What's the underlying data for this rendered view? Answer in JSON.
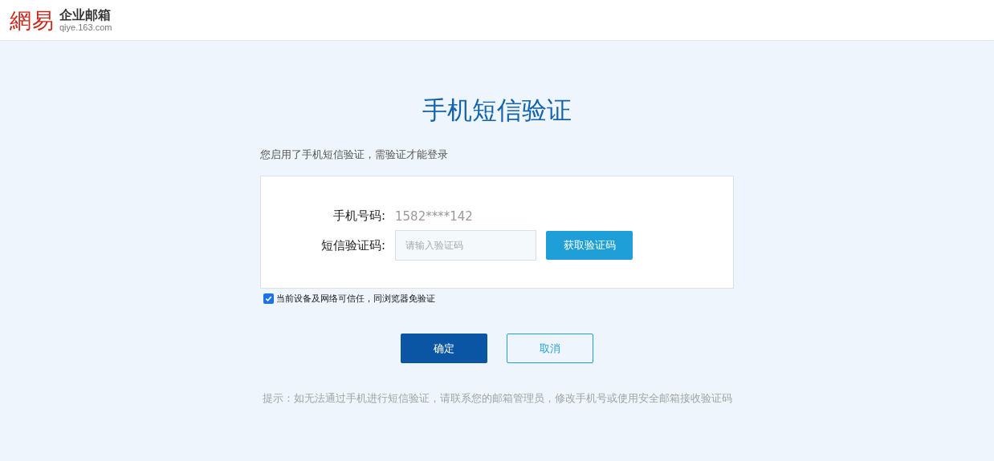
{
  "header": {
    "logo_mark": "網易",
    "product": "企业邮箱",
    "domain": "qiye.163.com"
  },
  "title": "手机短信验证",
  "subtitle": "您启用了手机短信验证，需验证才能登录",
  "form": {
    "phone_label": "手机号码:",
    "phone_value": "1582****142",
    "code_label": "短信验证码:",
    "code_placeholder": "请输入验证码",
    "get_code_button": "获取验证码"
  },
  "trust_device": {
    "label": "当前设备及网络可信任，同浏览器免验证",
    "checked": true
  },
  "buttons": [
    {
      "kind": "primary",
      "label": "确定"
    },
    {
      "kind": "secondary",
      "label": "取消"
    }
  ],
  "hint": "提示：如无法通过手机进行短信验证，请联系您的邮箱管理员，修改手机号或使用安全邮箱接收验证码"
}
